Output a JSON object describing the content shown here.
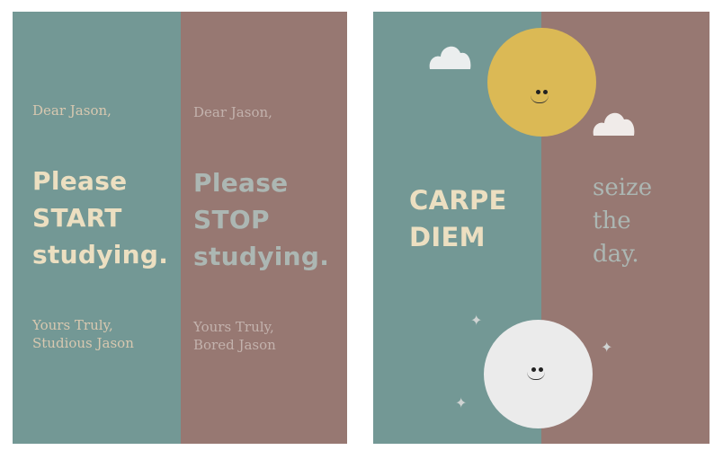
{
  "card1": {
    "left": {
      "greeting": "Dear Jason,",
      "line1": "Please",
      "line2": "START",
      "line3": "studying.",
      "sign1": "Yours Truly,",
      "sign2": "Studious Jason"
    },
    "right": {
      "greeting": "Dear Jason,",
      "line1": "Please",
      "line2": "STOP",
      "line3": "studying.",
      "sign1": "Yours Truly,",
      "sign2": "Bored Jason"
    }
  },
  "card2": {
    "left": {
      "line1": "CARPE",
      "line2": "DIEM"
    },
    "right": {
      "line1": "seize",
      "line2": "the",
      "line3": "day."
    }
  },
  "colors": {
    "teal": "#739895",
    "mauve": "#977872",
    "sun": "#dbb955",
    "moon": "#ebebeb",
    "cream_text": "#ecdfc1"
  },
  "icons": [
    "cloud-icon",
    "sun-face-icon",
    "moon-face-icon",
    "sparkle-icon"
  ]
}
